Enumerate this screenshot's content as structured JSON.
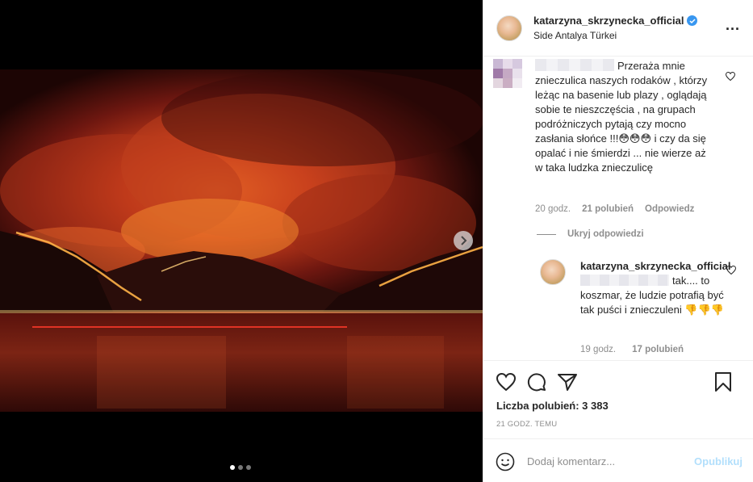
{
  "post": {
    "username": "katarzyna_skrzynecka_official",
    "location": "Side Antalya Türkei",
    "more_icon": "ellipsis-icon",
    "likes_text": "Liczba polubień: 3 383",
    "time_text": "21 GODZ. TEMU"
  },
  "carousel": {
    "slides": 3,
    "active_index": 0
  },
  "comments": [
    {
      "text": "Przeraża mnie znieczulica naszych rodaków , którzy leżąc na basenie lub plazy , oglądają sobie te nieszczęścia , na grupach podróżniczych pytają czy mocno zasłania słońce !!!😳😳😳 i czy da się opalać i nie śmierdzi ... nie wierze aż w taka ludzka znieczulicę",
      "time": "20 godz.",
      "likes": "21 polubień",
      "reply_label": "Odpowiedz"
    }
  ],
  "hide_replies": "Ukryj odpowiedzi",
  "reply": {
    "username": "katarzyna_skrzynecka_official",
    "text": "tak.... to koszmar, że ludzie potrafią być tak puści i znieczuleni 👎👎👎",
    "time": "19 godz.",
    "likes": "17 polubień"
  },
  "composer": {
    "placeholder": "Dodaj komentarz...",
    "post_label": "Opublikuj"
  },
  "colors": {
    "verified": "#3897f0",
    "muted": "#8e8e8e",
    "post_disabled": "#b2dffc"
  }
}
